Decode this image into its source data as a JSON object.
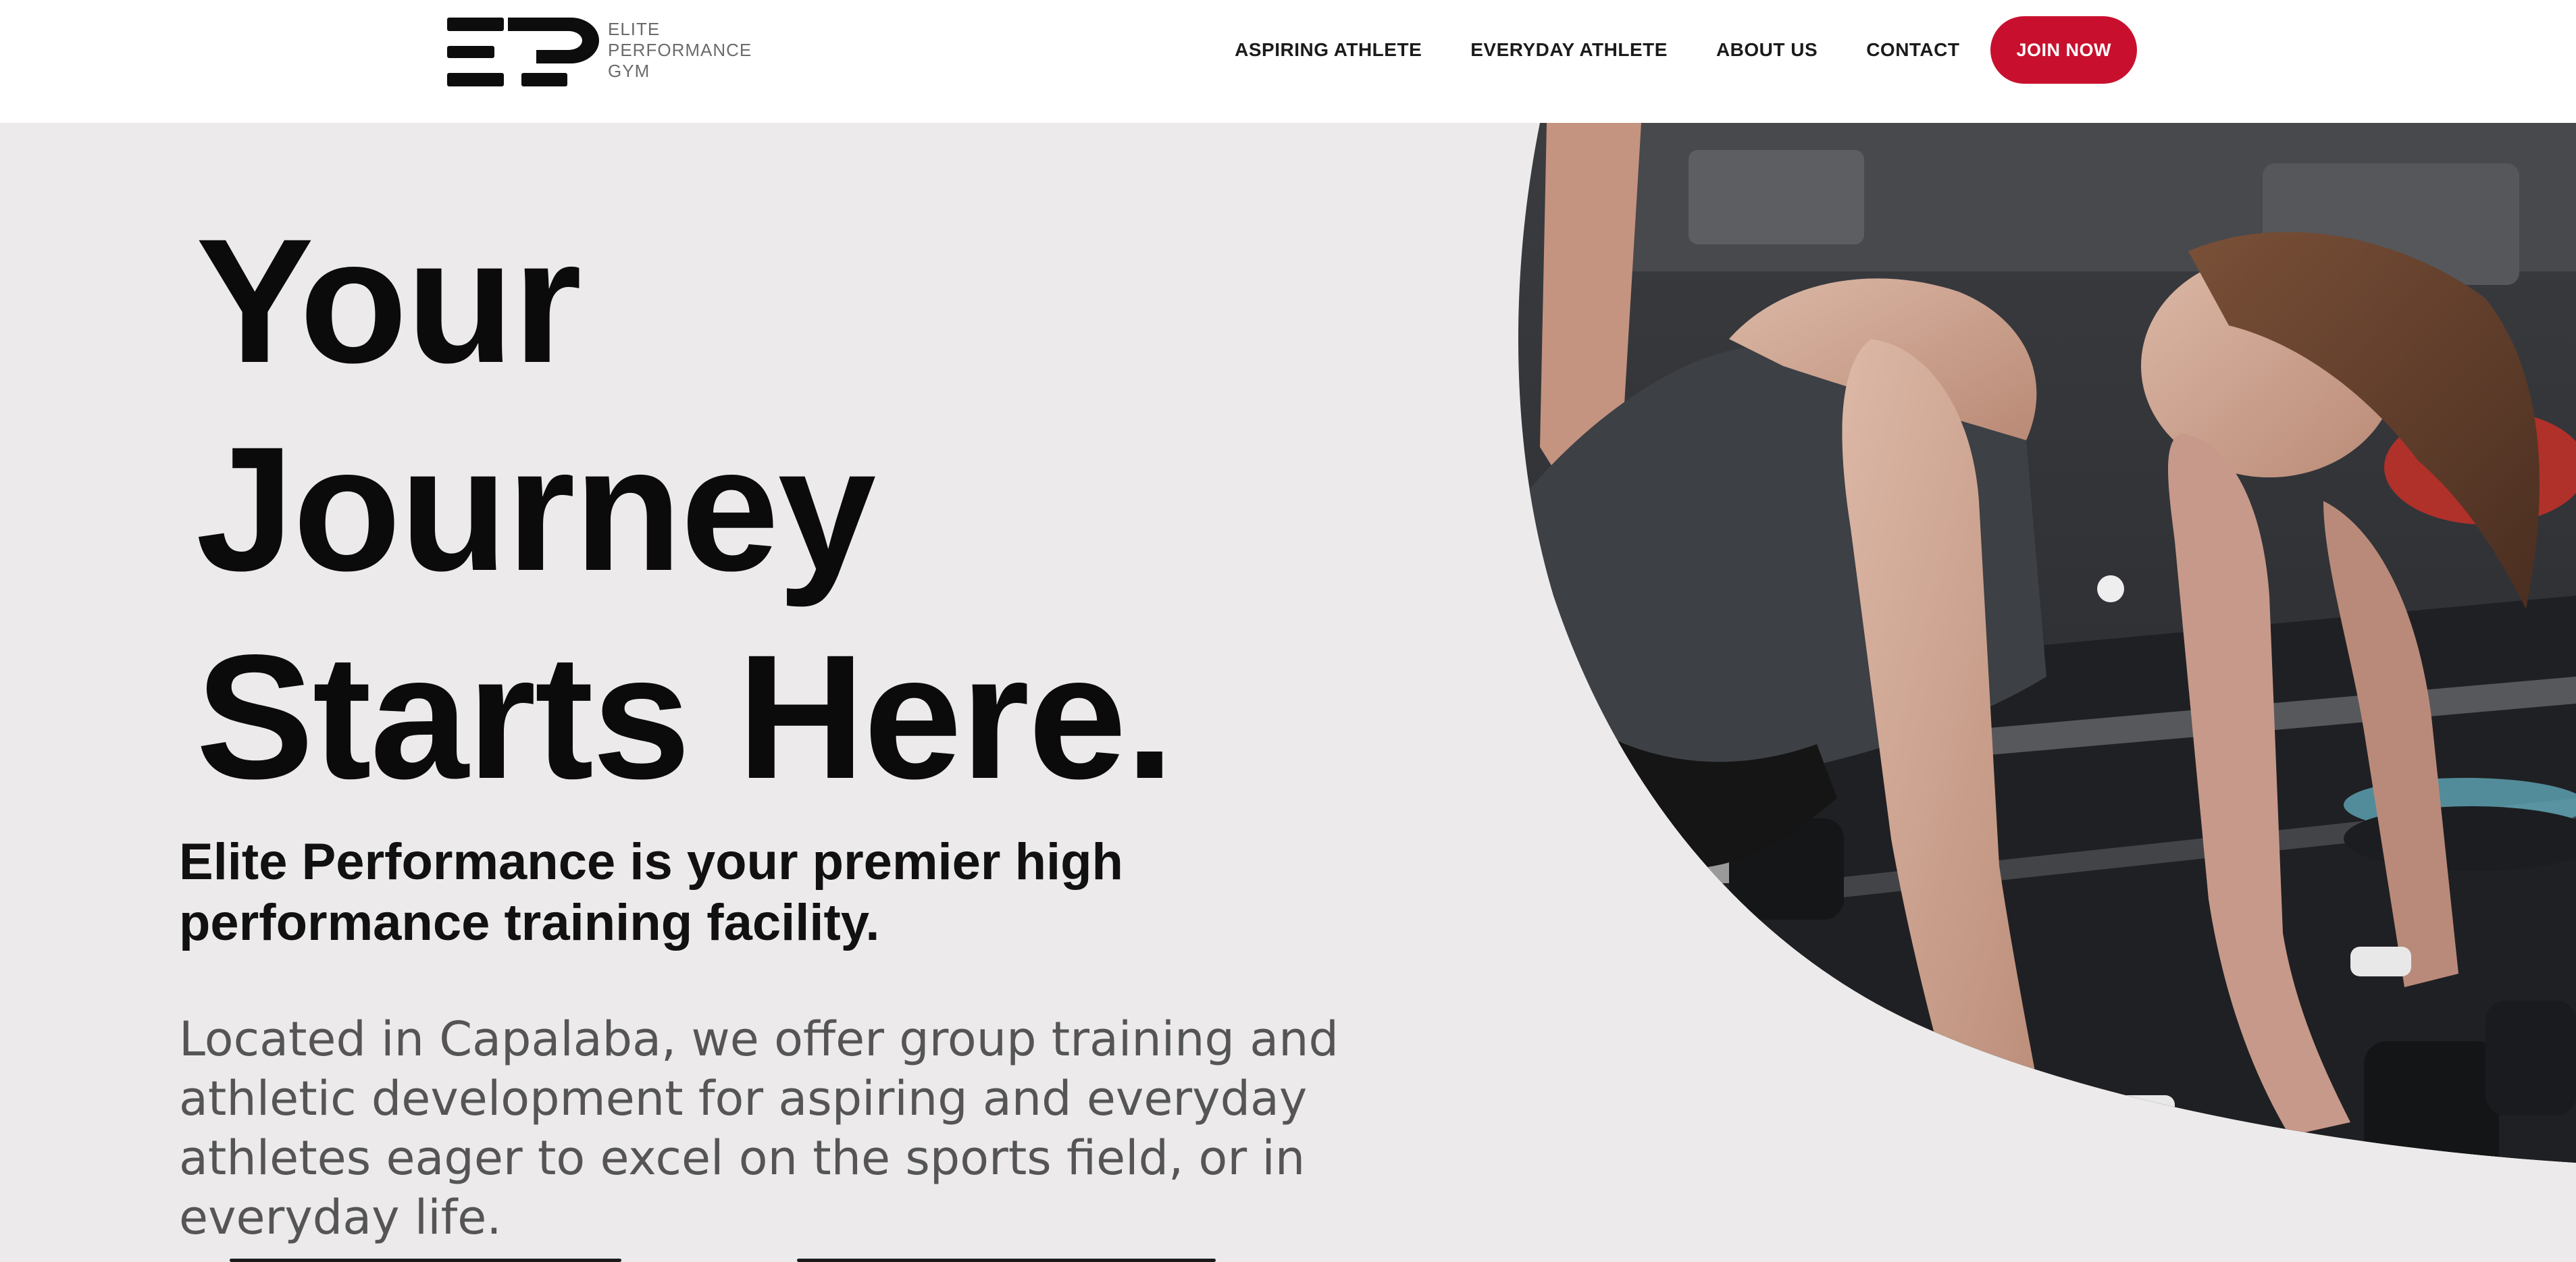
{
  "brand": {
    "logo_lines": [
      "ELITE",
      "PERFORMANCE",
      "GYM"
    ],
    "accent_color": "#c8102e"
  },
  "nav": {
    "items": [
      {
        "label": "ASPIRING ATHLETE"
      },
      {
        "label": "EVERYDAY ATHLETE"
      },
      {
        "label": "ABOUT US"
      },
      {
        "label": "CONTACT"
      }
    ],
    "cta_label": "JOIN NOW"
  },
  "hero": {
    "title_lines": [
      "Your",
      "Journey",
      "Starts Here."
    ],
    "subtitle": "Elite Performance is your premier high performance training facility.",
    "body": "Located in Capalaba, we offer group training and athletic development for aspiring and everyday athletes eager to excel on the sports field, or in everyday life.",
    "background_color": "#eceaea",
    "photo_icon": "athlete-dumbbell-pushup-photo"
  }
}
